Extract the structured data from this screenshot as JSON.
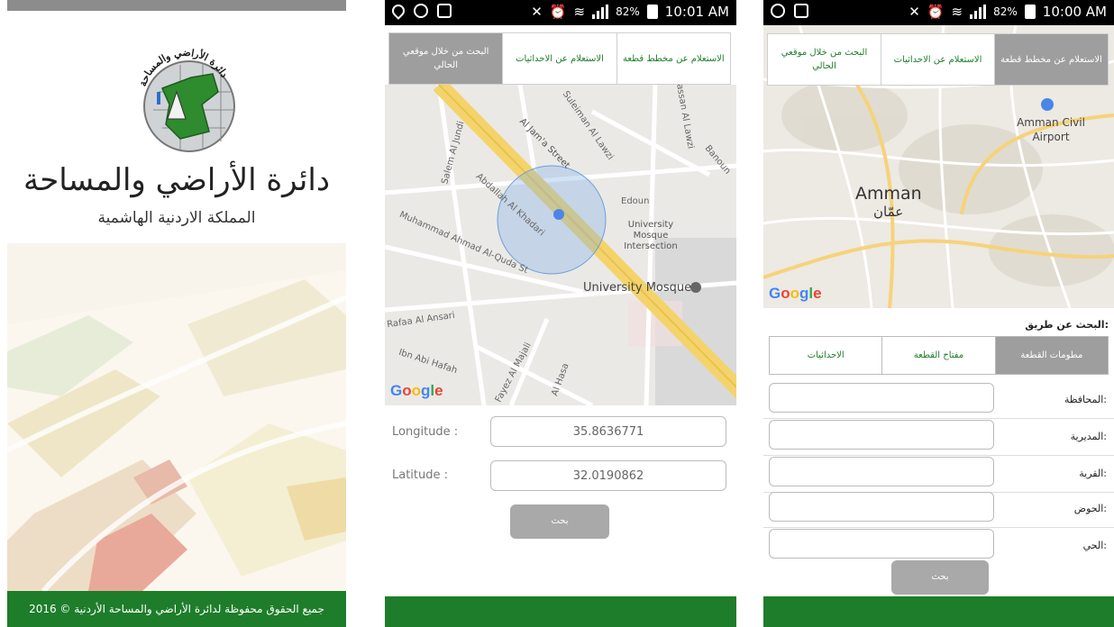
{
  "splash": {
    "title": "دائرة الأراضي والمساحة",
    "subtitle": "المملكة الاردنية الهاشمية",
    "logo_ring_text": "دائرة الأراضي والمساحة",
    "footer": "جميع الحقوق محفوظة لدائرة الأراضي والمساحة الأردنية © 2016"
  },
  "status_middle": {
    "battery": "82%",
    "time": "10:01 AM"
  },
  "status_right": {
    "battery": "82%",
    "time": "10:00 AM"
  },
  "tabs": [
    {
      "label": "الاستعلام عن مخطط قطعة"
    },
    {
      "label": "الاستعلام عن الاحداثيات"
    },
    {
      "label": "البحث من خلال موقعي الحالي"
    }
  ],
  "middle": {
    "map_labels": {
      "street1": "Al Jam'a Street",
      "street2": "Suleiman Al Lawzi",
      "street3": "Abdallah Al Khadari",
      "street4": "Muhammad Ahmad Al-Quda St",
      "street5": "Salem Al Jundi",
      "street6": "Rafaa Al Ansari",
      "street7": "Ibn Abi Hafah",
      "street8": "Fayez Al Majali",
      "street9": "Al Hasa",
      "street10": "Edoun",
      "street11": "Banoun",
      "street12": "Hassan Al Lawzi",
      "intersection": "University Mosque Intersection",
      "mosque": "University Mosque",
      "google": "Google"
    },
    "longitude_label": "Longitude :",
    "longitude_value": "35.8636771",
    "latitude_label": "Latitude :",
    "latitude_value": "32.0190862",
    "search_button": "بحث"
  },
  "right": {
    "map_labels": {
      "city_en": "Amman",
      "city_ar": "عمّان",
      "airport": "Amman Civil Airport",
      "google": "Google"
    },
    "search_by": "البحث عن طريق:",
    "segments": [
      "مطومات القطعة",
      "مفتاح القطعة",
      "الاحداثيات"
    ],
    "fields": [
      {
        "label": "المحافظة:"
      },
      {
        "label": "المديرية:"
      },
      {
        "label": "القرية:"
      },
      {
        "label": "الحوض:"
      },
      {
        "label": "الحي:"
      }
    ],
    "search_button": "بحث"
  },
  "colors": {
    "brand_green": "#1e7d2a",
    "tab_active": "#9e9e9e",
    "map_road": "#f4d36b"
  }
}
